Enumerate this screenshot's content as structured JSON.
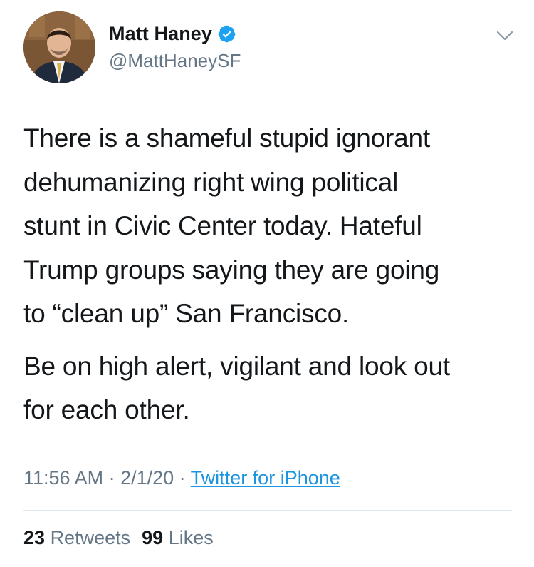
{
  "author": {
    "display_name": "Matt Haney",
    "handle": "@MattHaneySF",
    "verified": true,
    "avatar_icon": "profile-photo"
  },
  "tweet": {
    "paragraphs": [
      "There is a shameful stupid ignorant\ndehumanizing right wing political\nstunt in Civic Center today.  Hateful\nTrump groups saying they are going\nto “clean up” San Francisco.",
      "Be on high alert, vigilant and look out\nfor each other."
    ]
  },
  "meta": {
    "time": "11:56 AM",
    "separator": " · ",
    "date": "2/1/20",
    "source": "Twitter for iPhone"
  },
  "stats": {
    "retweets_count": "23",
    "retweets_label": "Retweets",
    "likes_count": "99",
    "likes_label": "Likes"
  },
  "colors": {
    "text": "#14171a",
    "secondary": "#657786",
    "link": "#1b95e0",
    "verified_badge": "#1da1f2",
    "divider": "#e1e8ed"
  },
  "icons": {
    "verified": "verified-badge-icon",
    "menu": "chevron-down-icon"
  }
}
